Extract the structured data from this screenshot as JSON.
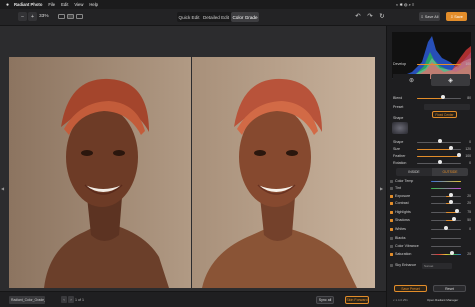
{
  "menubar": {
    "apple": "",
    "app_name": "Radiant Photo",
    "items": [
      "File",
      "Edit",
      "View",
      "Help"
    ]
  },
  "toolbar": {
    "zoom_minus": "−",
    "zoom_plus": "+",
    "zoom_value": "33%",
    "modes": [
      "Quick Edit",
      "Detailed Edit",
      "Color Grade"
    ],
    "active_mode": "Color Grade",
    "save_all_label": "Save All",
    "save_label": "Save"
  },
  "bottombar": {
    "thumbnail_name": "Radiant_Color_Grade_",
    "page_count": "1 of 1",
    "sync_all_label": "Sync all",
    "forward_label": "Skin Forward"
  },
  "panel": {
    "develop_label": "Develop",
    "develop_value": "100",
    "blend_label": "Blend",
    "blend_value": "80",
    "preset_label": "Preset",
    "shape_label": "Shape",
    "fixed_center_label": "Fixed Center",
    "shape_sliders": [
      {
        "label": "Shape",
        "value": "0"
      },
      {
        "label": "Size",
        "value": "120"
      },
      {
        "label": "Feather",
        "value": "100"
      },
      {
        "label": "Rotation",
        "value": "0"
      }
    ],
    "inside_label": "INSIDE",
    "outside_label": "OUTSIDE",
    "adjustments": [
      {
        "label": "Color Temp",
        "value": "",
        "enabled": false
      },
      {
        "label": "Tint",
        "value": "",
        "enabled": false
      },
      {
        "label": "Exposure",
        "value": "20",
        "enabled": true
      },
      {
        "label": "Contrast",
        "value": "20",
        "enabled": true
      },
      {
        "label": "Highlights",
        "value": "75",
        "enabled": true
      },
      {
        "label": "Shadows",
        "value": "50",
        "enabled": true
      },
      {
        "label": "Whites",
        "value": "0",
        "enabled": true
      },
      {
        "label": "Blacks",
        "value": "",
        "enabled": false
      },
      {
        "label": "Color Vibrance",
        "value": "",
        "enabled": false
      },
      {
        "label": "Saturation",
        "value": "20",
        "enabled": true
      },
      {
        "label": "Sky Enhance",
        "value": "",
        "enabled": false
      }
    ],
    "sky_placeholder": "Sunset",
    "save_preset_label": "Save Preset",
    "reset_label": "Reset",
    "version": "v 1.4.0.251",
    "manager_label": "Open Radiant Manager"
  },
  "colors": {
    "accent": "#e38d2a",
    "panel_bg": "#1e1e20",
    "canvas_bg": "#2c2c2e"
  }
}
